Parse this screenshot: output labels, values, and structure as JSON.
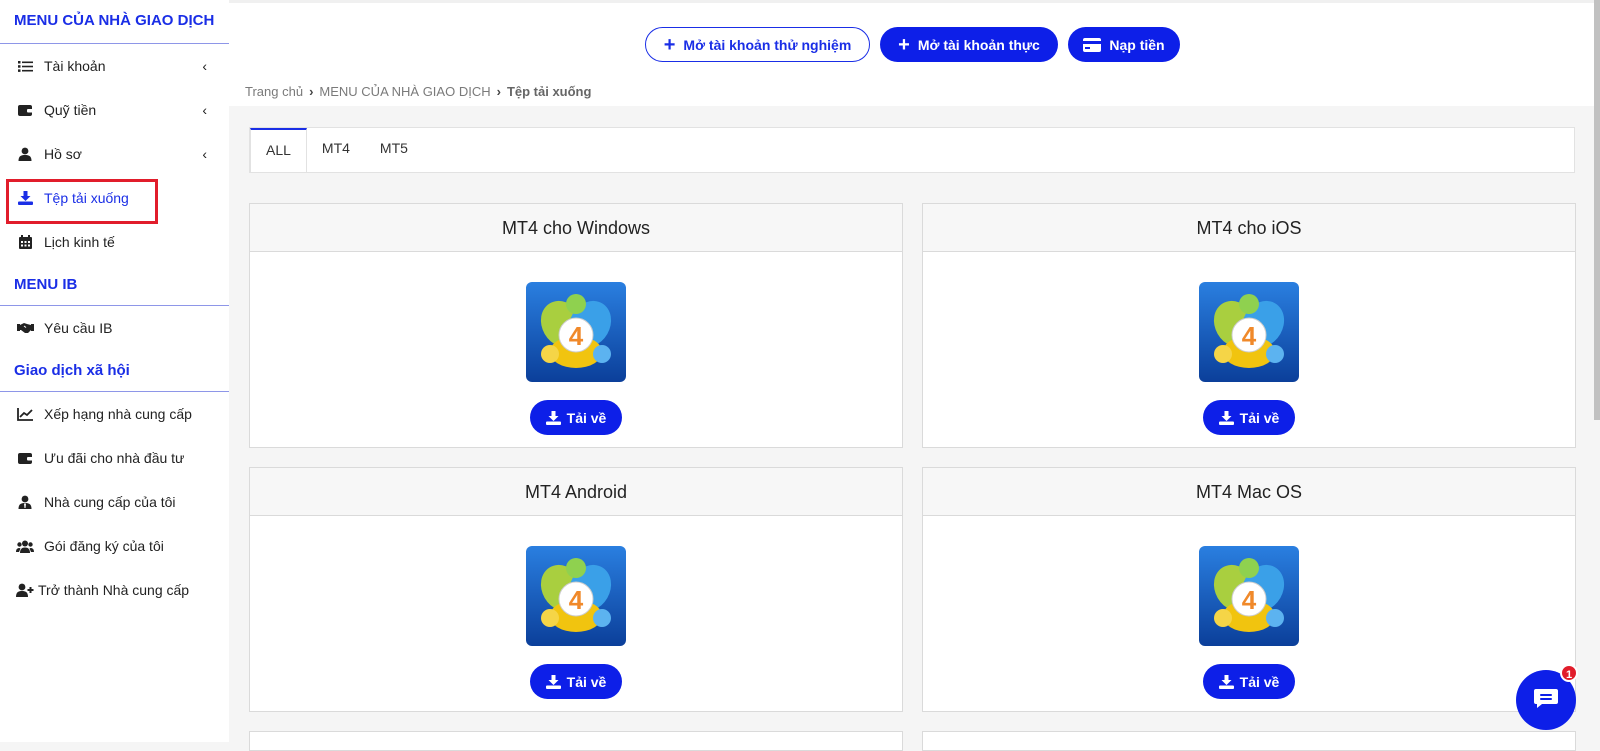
{
  "sidebar": {
    "trader_title": "MENU CỦA NHÀ GIAO DỊCH",
    "trader_items": [
      {
        "label": "Tài khoản"
      },
      {
        "label": "Quỹ tiền"
      },
      {
        "label": "Hồ sơ"
      },
      {
        "label": "Tệp tải xuống"
      },
      {
        "label": "Lịch kinh tế"
      }
    ],
    "ib_title": "MENU IB",
    "ib_items": [
      {
        "label": "Yêu cầu IB"
      }
    ],
    "social_title": "Giao dịch xã hội",
    "social_items": [
      {
        "label": "Xếp hạng nhà cung cấp"
      },
      {
        "label": "Ưu đãi cho nhà đầu tư"
      },
      {
        "label": "Nhà cung cấp của tôi"
      },
      {
        "label": "Gói đăng ký của tôi"
      },
      {
        "label": "Trở thành Nhà cung cấp"
      }
    ]
  },
  "header": {
    "demo_label": "Mở tài khoản thử nghiệm",
    "real_label": "Mở tài khoản thực",
    "deposit_label": "Nạp tiền"
  },
  "breadcrumb": {
    "home": "Trang chủ",
    "parent": "MENU CỦA NHÀ GIAO DỊCH",
    "current": "Tệp tải xuống"
  },
  "tabs": [
    {
      "label": "ALL"
    },
    {
      "label": "MT4"
    },
    {
      "label": "MT5"
    }
  ],
  "cards": [
    {
      "title": "MT4 cho Windows",
      "button": "Tải về"
    },
    {
      "title": "MT4 cho iOS",
      "button": "Tải về"
    },
    {
      "title": "MT4 Android",
      "button": "Tải về"
    },
    {
      "title": "MT4 Mac OS",
      "button": "Tải về"
    }
  ],
  "chat": {
    "badge": "1"
  },
  "colors": {
    "accent": "#0d1fe8",
    "highlight": "#e11d2b"
  }
}
